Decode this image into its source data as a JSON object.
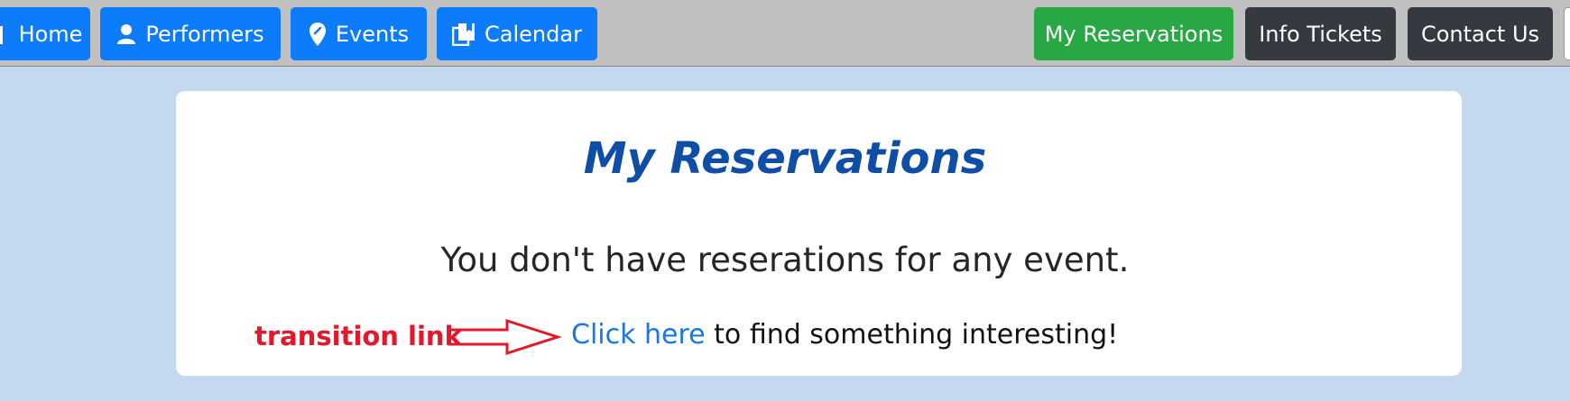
{
  "nav": {
    "left": [
      {
        "label": "Home",
        "icon": "home-icon"
      },
      {
        "label": "Performers",
        "icon": "person-icon"
      },
      {
        "label": "Events",
        "icon": "location-pin-icon"
      },
      {
        "label": "Calendar",
        "icon": "book-icon"
      }
    ],
    "right": [
      {
        "label": "My Reservations",
        "color": "#28a745"
      },
      {
        "label": "Info Tickets",
        "color": "#343a40"
      },
      {
        "label": "Contact Us",
        "color": "#343a40"
      }
    ]
  },
  "main": {
    "title": "My Reservations",
    "message": "You don't have reserations for any event.",
    "link_text": "Click here",
    "link_suffix": " to find something interesting!"
  },
  "annotation": {
    "label": "transition link",
    "color": "#e3182b"
  },
  "colors": {
    "page_background": "#c4d9ef",
    "topbar_background": "#c0c0c0",
    "primary_button": "#0d7cfb",
    "title_color": "#0f4ea6",
    "link_color": "#1877e8"
  }
}
